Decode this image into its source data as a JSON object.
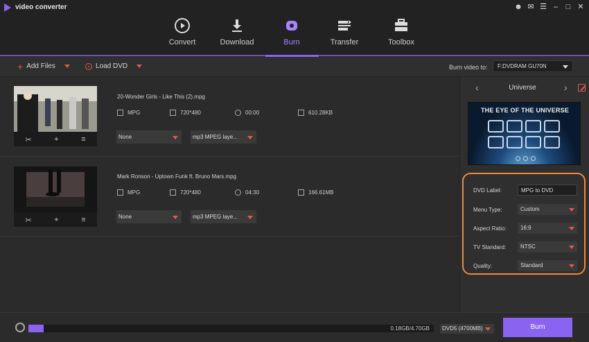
{
  "app": {
    "title": "video converter"
  },
  "nav": {
    "tabs": [
      {
        "label": "Convert",
        "icon": "convert-icon"
      },
      {
        "label": "Download",
        "icon": "download-icon"
      },
      {
        "label": "Burn",
        "icon": "burn-icon",
        "active": true
      },
      {
        "label": "Transfer",
        "icon": "transfer-icon"
      },
      {
        "label": "Toolbox",
        "icon": "toolbox-icon"
      }
    ]
  },
  "toolbar": {
    "add_files": "Add Files",
    "load_dvd": "Load DVD",
    "burn_to_label": "Burn video to:",
    "burn_to_value": "F:DVDRAM GU70N"
  },
  "files": [
    {
      "name": "20-Wonder Girls - Like This (2).mpg",
      "format": "MPG",
      "resolution": "720*480",
      "duration": "00:00",
      "size": "610.28KB",
      "subtitle": "None",
      "audio": "mp3 MPEG laye..."
    },
    {
      "name": "Mark Ronson - Uptown Funk ft. Bruno Mars.mpg",
      "format": "MPG",
      "resolution": "720*480",
      "duration": "04:30",
      "size": "166.61MB",
      "subtitle": "None",
      "audio": "mp3 MPEG laye..."
    }
  ],
  "template": {
    "name": "Universe",
    "preview_title": "THE EYE OF THE UNIVERSE"
  },
  "settings": {
    "dvd_label": {
      "label": "DVD Label:",
      "value": "MPG to DVD"
    },
    "menu_type": {
      "label": "Menu Type:",
      "value": "Custom"
    },
    "aspect_ratio": {
      "label": "Aspect Ratio:",
      "value": "16:9"
    },
    "tv_standard": {
      "label": "TV Standard:",
      "value": "NTSC"
    },
    "quality": {
      "label": "Quality:",
      "value": "Standard"
    }
  },
  "bottom": {
    "progress_text": "0.18GB/4.70GB",
    "progress_fraction": 0.038,
    "disc_size": "DVD5 (4700MB)",
    "burn_label": "Burn"
  },
  "colors": {
    "accent": "#8a63f0",
    "highlight": "#f08a3c",
    "icon_red": "#e05a4a"
  }
}
